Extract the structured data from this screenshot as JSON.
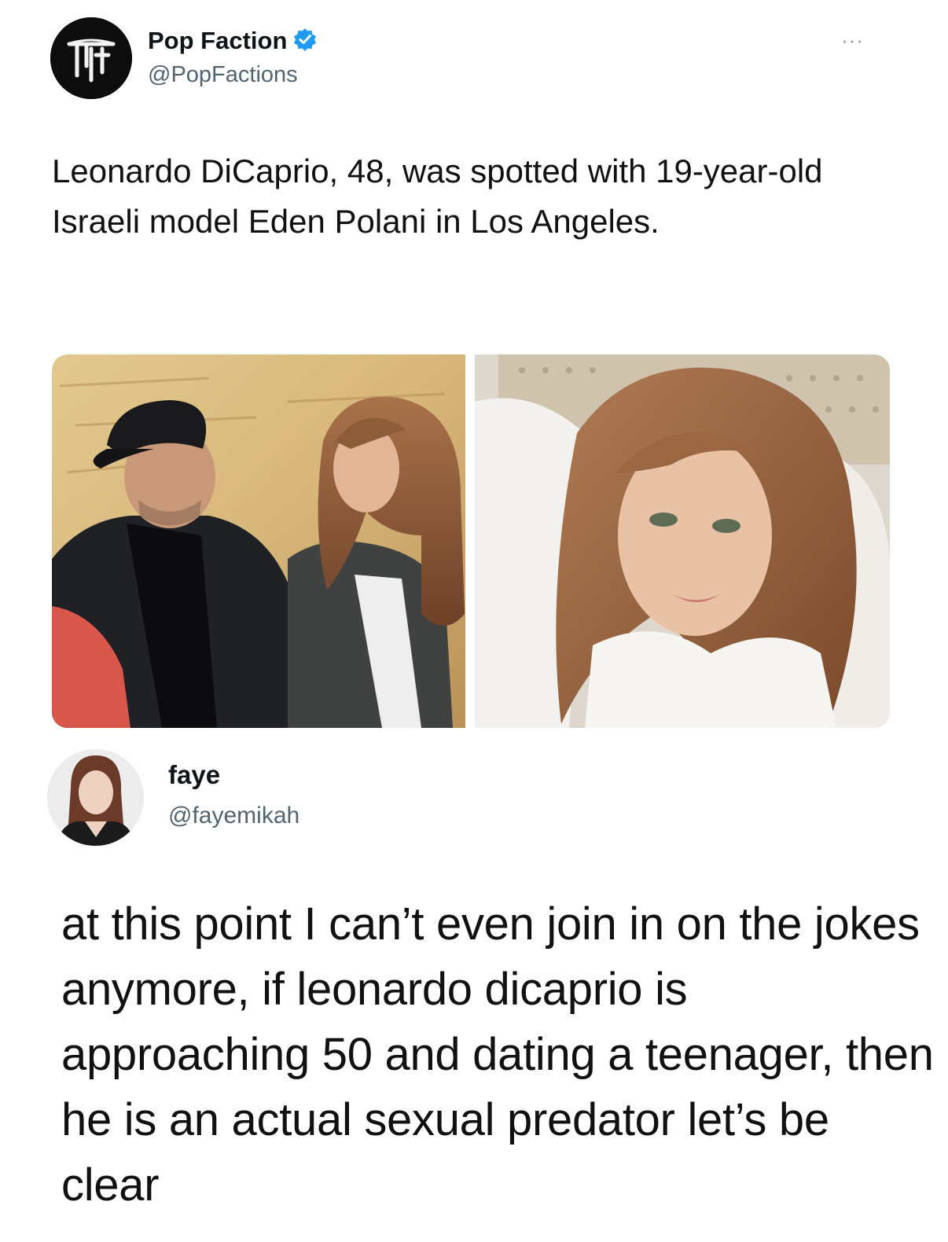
{
  "tweet": {
    "author_name": "Pop Faction",
    "author_handle": "@PopFactions",
    "avatar_logo_text": "PF",
    "verified": true,
    "more_label": "···",
    "text": "Leonardo DiCaprio, 48, was spotted with 19-year-old Israeli model Eden Polani in Los Angeles.",
    "media": [
      {
        "name": "photo-man-with-cap-and-woman"
      },
      {
        "name": "photo-woman-selfie"
      }
    ]
  },
  "reply": {
    "author_name": "faye",
    "author_handle": "@fayemikah",
    "text": "at this point I can’t even join in on the jokes anymore, if leonardo dicaprio is approaching 50 and dating a teenager, then he is an actual sexual predator let’s be clear"
  },
  "colors": {
    "verified_badge": "#1d9bf0",
    "handle_gray": "#536471",
    "text": "#0f1419"
  }
}
